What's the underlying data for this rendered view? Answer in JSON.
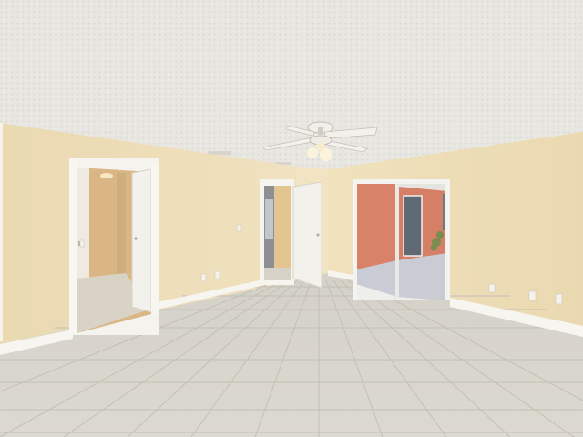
{
  "scene": {
    "subject": "empty-room",
    "colors": {
      "ceiling": "#e7e6e1",
      "wall": "#eedfb9",
      "wall_shadow": "#e6d3a6",
      "floor": "#d8d5cc",
      "floor_grout": "#c2beb4",
      "trim": "#f6f4ee",
      "door": "#f3f1ec",
      "exterior_wall": "#d9826a",
      "patio": "#c9ccd4",
      "bath_wall": "#d9b684"
    },
    "elements": [
      "ceiling-fan",
      "ceiling-vent",
      "bathroom-doorway",
      "closet-doorway",
      "sliding-glass-door",
      "baseboard",
      "electrical-outlets",
      "light-switches"
    ]
  }
}
